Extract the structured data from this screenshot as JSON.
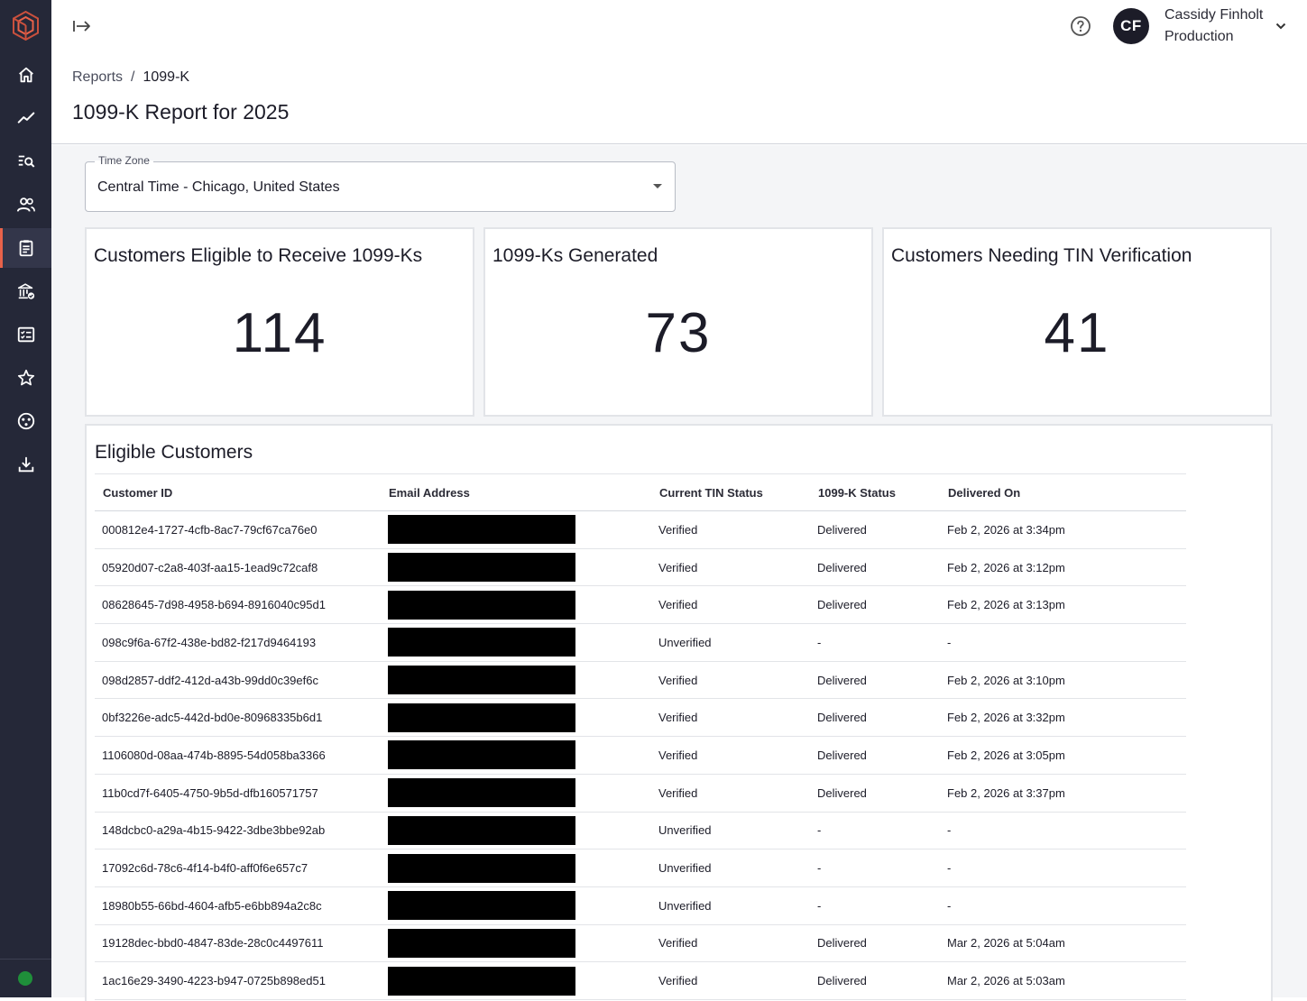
{
  "sidebar": {
    "logo_icon": "cube-logo-icon",
    "items": [
      {
        "icon": "home-icon",
        "active": false
      },
      {
        "icon": "trend-line-icon",
        "active": false
      },
      {
        "icon": "search-list-icon",
        "active": false
      },
      {
        "icon": "users-icon",
        "active": false
      },
      {
        "icon": "clipboard-report-icon",
        "active": true
      },
      {
        "icon": "bank-check-icon",
        "active": false
      },
      {
        "icon": "checklist-icon",
        "active": false
      },
      {
        "icon": "star-icon",
        "active": false
      },
      {
        "icon": "connections-icon",
        "active": false
      },
      {
        "icon": "download-icon",
        "active": false
      }
    ],
    "status_color": "#1f8f3a"
  },
  "header": {
    "collapse_icon": "collapse-arrow-icon",
    "help_icon": "help-circle-icon",
    "user_initials": "CF",
    "user_name": "Cassidy Finholt",
    "user_environment": "Production",
    "breadcrumb": {
      "parent": "Reports",
      "separator": "/",
      "current": "1099-K"
    },
    "page_title": "1099-K Report for 2025"
  },
  "timezone": {
    "label": "Time Zone",
    "value": "Central Time - Chicago, United States"
  },
  "stats": [
    {
      "title": "Customers Eligible to Receive 1099-Ks",
      "value": "114"
    },
    {
      "title": "1099-Ks Generated",
      "value": "73"
    },
    {
      "title": "Customers Needing TIN Verification",
      "value": "41"
    }
  ],
  "table": {
    "title": "Eligible Customers",
    "columns": [
      "Customer ID",
      "Email Address",
      "Current TIN Status",
      "1099-K Status",
      "Delivered On"
    ],
    "rows": [
      {
        "id": "000812e4-1727-4cfb-8ac7-79cf67ca76e0",
        "tin": "Verified",
        "status": "Delivered",
        "delivered": "Feb 2, 2026 at 3:34pm"
      },
      {
        "id": "05920d07-c2a8-403f-aa15-1ead9c72caf8",
        "tin": "Verified",
        "status": "Delivered",
        "delivered": "Feb 2, 2026 at 3:12pm"
      },
      {
        "id": "08628645-7d98-4958-b694-8916040c95d1",
        "tin": "Verified",
        "status": "Delivered",
        "delivered": "Feb 2, 2026 at 3:13pm"
      },
      {
        "id": "098c9f6a-67f2-438e-bd82-f217d9464193",
        "tin": "Unverified",
        "status": "-",
        "delivered": "-"
      },
      {
        "id": "098d2857-ddf2-412d-a43b-99dd0c39ef6c",
        "tin": "Verified",
        "status": "Delivered",
        "delivered": "Feb 2, 2026 at 3:10pm"
      },
      {
        "id": "0bf3226e-adc5-442d-bd0e-80968335b6d1",
        "tin": "Verified",
        "status": "Delivered",
        "delivered": "Feb 2, 2026 at 3:32pm"
      },
      {
        "id": "1106080d-08aa-474b-8895-54d058ba3366",
        "tin": "Verified",
        "status": "Delivered",
        "delivered": "Feb 2, 2026 at 3:05pm"
      },
      {
        "id": "11b0cd7f-6405-4750-9b5d-dfb160571757",
        "tin": "Verified",
        "status": "Delivered",
        "delivered": "Feb 2, 2026 at 3:37pm"
      },
      {
        "id": "148dcbc0-a29a-4b15-9422-3dbe3bbe92ab",
        "tin": "Unverified",
        "status": "-",
        "delivered": "-"
      },
      {
        "id": "17092c6d-78c6-4f14-b4f0-aff0f6e657c7",
        "tin": "Unverified",
        "status": "-",
        "delivered": "-"
      },
      {
        "id": "18980b55-66bd-4604-afb5-e6bb894a2c8c",
        "tin": "Unverified",
        "status": "-",
        "delivered": "-"
      },
      {
        "id": "19128dec-bbd0-4847-83de-28c0c4497611",
        "tin": "Verified",
        "status": "Delivered",
        "delivered": "Mar 2, 2026 at 5:04am"
      },
      {
        "id": "1ac16e29-3490-4223-b947-0725b898ed51",
        "tin": "Verified",
        "status": "Delivered",
        "delivered": "Mar 2, 2026 at 5:03am"
      }
    ]
  },
  "colors": {
    "sidebar_bg": "#252838",
    "accent": "#e8624a",
    "content_bg": "#f4f5f7"
  }
}
